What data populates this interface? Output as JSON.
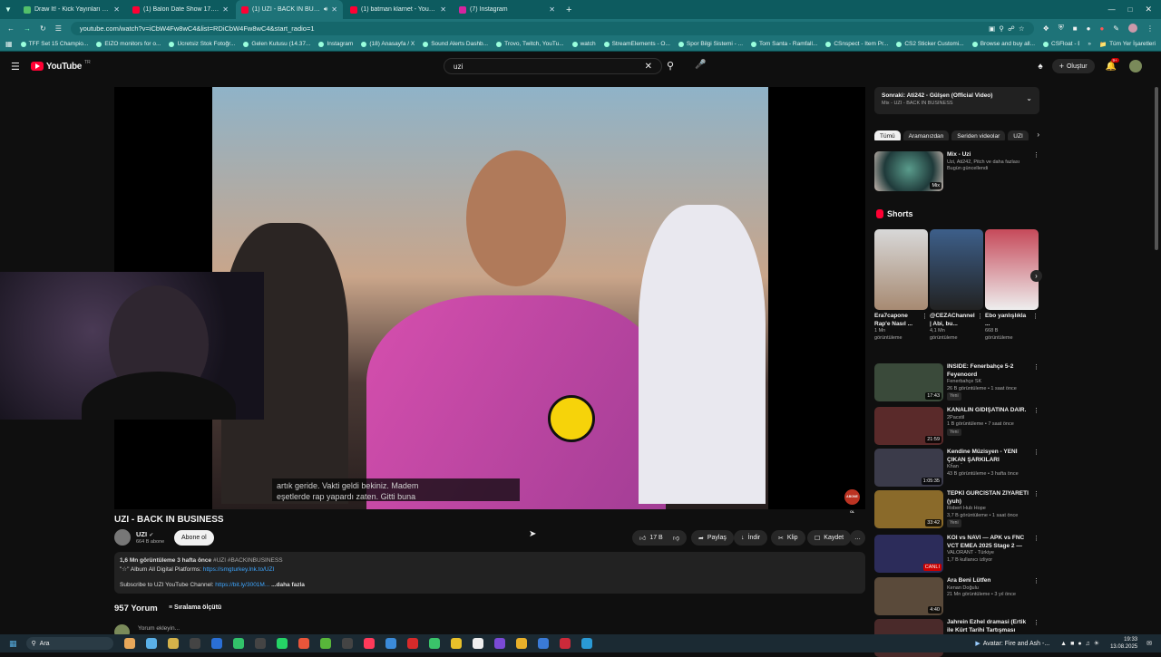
{
  "browser": {
    "tabs": [
      {
        "label": "Draw It! - Kick Yayınları İçin Çizi",
        "color": "#53c06a",
        "active": false
      },
      {
        "label": "(1) Balon Date Show 17. Bölüm",
        "color": "#ff0033",
        "active": false
      },
      {
        "label": "(1) UZI - BACK IN BUSINESS",
        "color": "#ff0033",
        "active": true
      },
      {
        "label": "(1) batman klarnet - YouTube",
        "color": "#ff0033",
        "active": false
      },
      {
        "label": "(7) Instagram",
        "color": "#d6249f",
        "active": false
      }
    ],
    "url": "youtube.com/watch?v=iCbW4Fw8wC4&list=RDiCbW4Fw8wC4&start_radio=1",
    "bookmarks": [
      "TFF Set 15 Champio...",
      "EIZO monitors for o...",
      "Ücretsiz Stok Fotoğr...",
      "Gelen Kutusu (14.37...",
      "Instagram",
      "(18) Anasayfa / X",
      "Sound Alerts Dashb...",
      "Trovo, Twitch, YouTu...",
      "watch",
      "StreamElements - O...",
      "Spor Bilgi Sistemi - ...",
      "Tom Santa - Ramfall...",
      "CSnspect - Item Pr...",
      "CS2 Sticker Customi...",
      "Browse and buy all...",
      "CSFloat - Buy & Sell..."
    ],
    "all_bookmarks": "Tüm Yer İşaretleri"
  },
  "yt": {
    "logo": "YouTube",
    "logo_region": "TR",
    "search_value": "uzi",
    "create_label": "Oluştur",
    "notif_count": "9+",
    "caption_lines": [
      "artık geride. Vakti geldi bekiniz. Madem",
      "eşetlerde rap yapardı zaten. Gitti buna"
    ],
    "video_title": "UZI - BACK IN BUSINESS",
    "channel": "UZI",
    "subs": "664 B abone",
    "subscribe": "Abone ol",
    "likes": "17 B",
    "share": "Paylaş",
    "download": "İndir",
    "clip": "Klip",
    "save": "Kaydet",
    "views_date": "1,6 Mn görüntüleme  3 hafta önce",
    "tag": "#UZI #BACKINBUSINESS",
    "desc_line1": "\"☆\" Album All Digital Platforms:",
    "desc_link1": "https://smgturkey.lnk.to/UZI",
    "desc_line2": "Subscribe to UZI YouTube Channel:",
    "desc_link2": "https://bit.ly/3001M...",
    "more": "...daha fazla",
    "comments_count": "957 Yorum",
    "sort": "Sıralama ölçütü",
    "add_comment": "Yorum ekleyin...",
    "watermark": "ABONE OL"
  },
  "sidebar": {
    "next_title": "Sonraki: Ati242 - Gülşen (Official Video)",
    "next_sub": "Mix - UZI - BACK IN BUSINESS",
    "chips": [
      "Tümü",
      "Aramanızdan",
      "Seriden videolar",
      "UZI"
    ],
    "mix": {
      "title": "Mix - Uzi",
      "sub": "Uzi, Ati242, Pitch ve daha fazlası",
      "updated": "Bugün güncellendi",
      "badge": "Mix"
    },
    "shorts_label": "Shorts",
    "shorts": [
      {
        "title": "Era7capone Rap'e Nasıl ...",
        "views": "1 Mn görüntüleme"
      },
      {
        "title": "@CEZAChannel | Abi, bu...",
        "views": "4,1 Mn görüntüleme"
      },
      {
        "title": "Ebo yanlışlıkla ...",
        "views": "668 B görüntüleme"
      }
    ],
    "videos": [
      {
        "title": "INSIDE: Fenerbahçe 5-2 Feyenoord",
        "channel": "Fenerbahçe SK",
        "meta": "26 B görüntüleme • 1 saat önce",
        "dur": "17:43",
        "new": "Yeni"
      },
      {
        "title": "KANALIN GİDİŞATINA DAİR.",
        "channel": "2Pacstil",
        "meta": "1 B görüntüleme • 7 saat önce",
        "dur": "21:59",
        "new": "Yeni"
      },
      {
        "title": "Kendine Müzisyen - YENİ ÇIKAN ŞARKILARI DİNLİYOR! ...",
        "channel": "Khan",
        "meta": "43 B görüntüleme • 3 hafta önce",
        "dur": "1:05:35",
        "new": ""
      },
      {
        "title": "TEPKİ GURCİSTAN ZİYARETİ (yuh)",
        "channel": "Robert Hub Hope",
        "meta": "3,7 B görüntüleme • 1 saat önce",
        "dur": "33:42",
        "new": "Yeni"
      },
      {
        "title": "KOI vs NAVI — APK vs FNC VCT EMEA 2025 Stage 2 — S...",
        "channel": "VALORANT - Türkiye",
        "meta": "1,7 B kullanıcı izliyor",
        "dur": "CANLI",
        "new": ""
      },
      {
        "title": "Ara Beni Lütfen",
        "channel": "Kenan Doğulu",
        "meta": "21 Mn görüntüleme • 3 yıl önce",
        "dur": "4:40",
        "new": ""
      },
      {
        "title": "Jahrein Ezhel dramasi (Ertik ile Kürt Tarihi Tartışması hakkınd...",
        "channel": "",
        "meta": "",
        "dur": "",
        "new": ""
      }
    ]
  },
  "taskbar": {
    "search": "Ara",
    "media": "Avatar: Fire and Ash -...",
    "time": "19:33",
    "date": "13.08.2025"
  }
}
